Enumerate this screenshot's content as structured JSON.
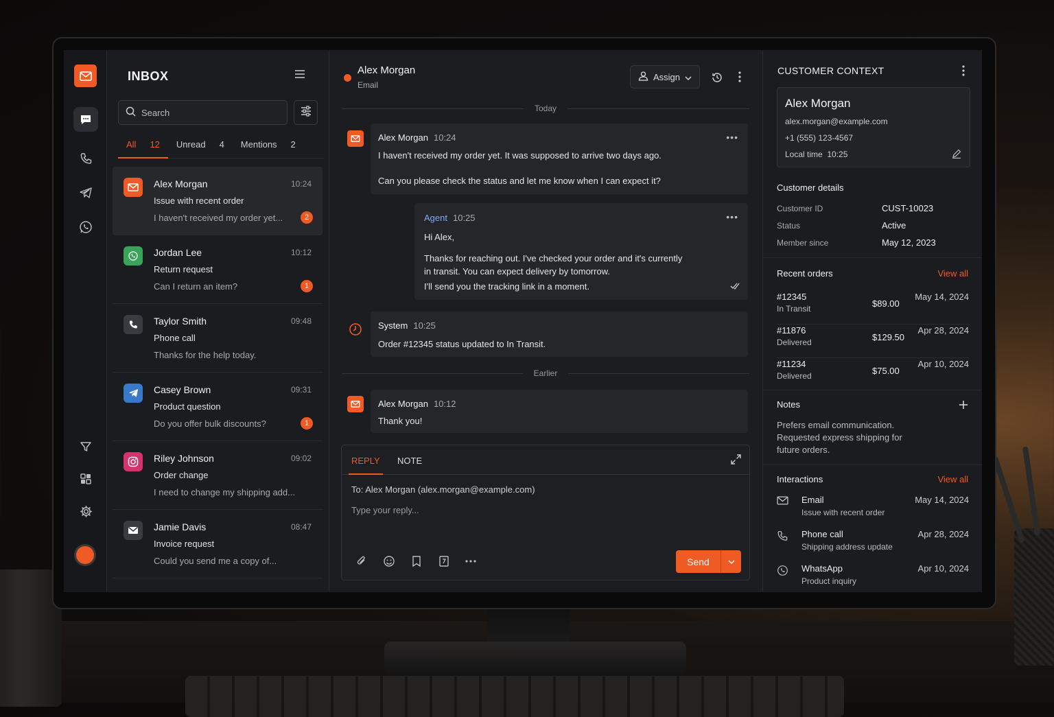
{
  "inbox": {
    "title": "INBOX",
    "search_placeholder": "Search",
    "tabs": [
      {
        "label": "All",
        "count": "12"
      },
      {
        "label": "Unread",
        "count": "4"
      },
      {
        "label": "Mentions",
        "count": "2"
      }
    ],
    "conversations": [
      {
        "name": "Alex Morgan",
        "time": "10:24",
        "subject": "Issue with recent order",
        "preview": "I haven't received my order yet...",
        "badge": "2",
        "channel": "email-icon"
      },
      {
        "name": "Jordan Lee",
        "time": "10:12",
        "subject": "Return request",
        "preview": "Can I return an item?",
        "badge": "1",
        "channel": "whatsapp-icon"
      },
      {
        "name": "Taylor Smith",
        "time": "09:48",
        "subject": "Phone call",
        "preview": "Thanks for the help today.",
        "badge": "",
        "channel": "phone-icon"
      },
      {
        "name": "Casey Brown",
        "time": "09:31",
        "subject": "Product question",
        "preview": "Do you offer bulk discounts?",
        "badge": "1",
        "channel": "telegram-icon"
      },
      {
        "name": "Riley Johnson",
        "time": "09:02",
        "subject": "Order change",
        "preview": "I need to change my shipping add...",
        "badge": "",
        "channel": "instagram-icon"
      },
      {
        "name": "Jamie Davis",
        "time": "08:47",
        "subject": "Invoice request",
        "preview": "Could you send me a copy of...",
        "badge": "",
        "channel": "email-icon"
      }
    ]
  },
  "chat": {
    "name": "Alex Morgan",
    "channel": "Email",
    "assign_label": "Assign",
    "today": "Today",
    "earlier": "Earlier",
    "messages": [
      {
        "who": "Alex Morgan",
        "time": "10:24",
        "lines": [
          "I haven't received my order yet. It was supposed to arrive two days ago.",
          "Can you please check the status and let me know when I can expect it?"
        ]
      },
      {
        "who": "Agent",
        "time": "10:25",
        "lines": [
          "Hi Alex,",
          "Thanks for reaching out. I've checked your order and it's currently",
          "in transit. You can expect delivery by tomorrow.",
          "I'll send you the tracking link in a moment."
        ]
      },
      {
        "who": "System",
        "time": "10:25",
        "lines": [
          "Order #12345 status updated to In Transit."
        ]
      },
      {
        "who": "Alex Morgan",
        "time": "10:12",
        "lines": [
          "Thank you!"
        ]
      }
    ],
    "composer": {
      "reply_tab": "REPLY",
      "note_tab": "NOTE",
      "to": "To:  Alex Morgan (alex.morgan@example.com)",
      "placeholder": "Type your reply...",
      "send": "Send"
    }
  },
  "context": {
    "title": "CUSTOMER CONTEXT",
    "name": "Alex Morgan",
    "email": "alex.morgan@example.com",
    "phone": "+1 (555) 123-4567",
    "local_time_label": "Local time",
    "local_time": "10:25",
    "details_title": "Customer details",
    "details": [
      {
        "k": "Customer ID",
        "v": "CUST-10023"
      },
      {
        "k": "Status",
        "v": "Active"
      },
      {
        "k": "Member since",
        "v": "May 12, 2023"
      }
    ],
    "orders_title": "Recent orders",
    "view_all": "View all",
    "orders": [
      {
        "id": "#12345",
        "status": "In Transit",
        "price": "$89.00",
        "date": "May 14, 2024"
      },
      {
        "id": "#11876",
        "status": "Delivered",
        "price": "$129.50",
        "date": "Apr 28, 2024"
      },
      {
        "id": "#11234",
        "status": "Delivered",
        "price": "$75.00",
        "date": "Apr 10, 2024"
      }
    ],
    "notes_title": "Notes",
    "notes": "Prefers email communication. Requested express shipping for future orders.",
    "interactions_title": "Interactions",
    "interactions": [
      {
        "type": "Email",
        "subject": "Issue with recent order",
        "date": "May 14, 2024"
      },
      {
        "type": "Phone call",
        "subject": "Shipping address update",
        "date": "Apr 28, 2024"
      },
      {
        "type": "WhatsApp",
        "subject": "Product inquiry",
        "date": "Apr 10, 2024"
      }
    ]
  },
  "colors": {
    "accent": "#f05a24",
    "whatsapp": "#3aa35a",
    "telegram": "#3a78c9",
    "instagram": "#d6336c"
  }
}
